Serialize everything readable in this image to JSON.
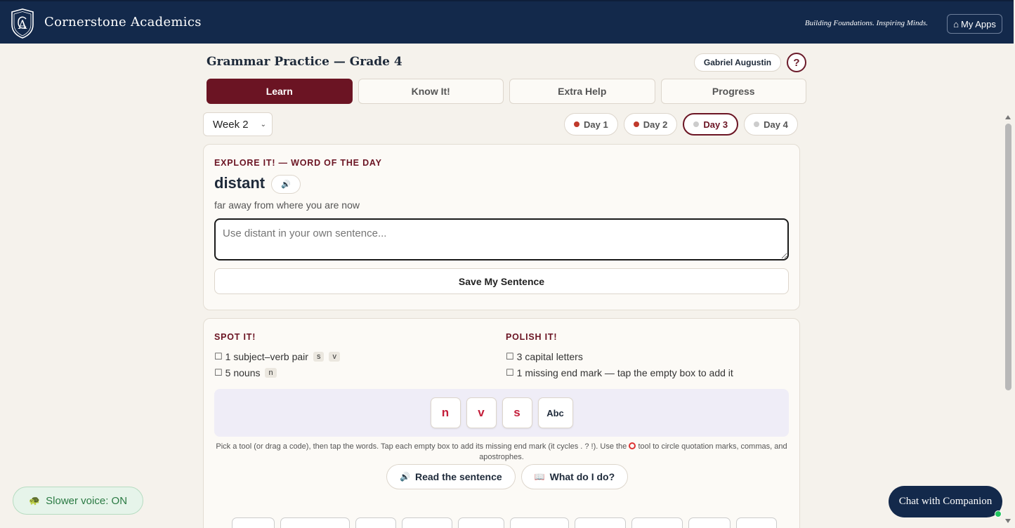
{
  "header": {
    "brand": "Cornerstone Academics",
    "tagline": "Building Foundations. Inspiring Minds.",
    "my_apps": "My Apps",
    "my_apps_icon": "home-icon"
  },
  "page": {
    "title": "Grammar Practice — Grade 4",
    "user_name": "Gabriel Augustin",
    "help_label": "?"
  },
  "tabs": [
    {
      "label": "Learn",
      "active": true
    },
    {
      "label": "Know It!",
      "active": false
    },
    {
      "label": "Extra Help",
      "active": false
    },
    {
      "label": "Progress",
      "active": false
    }
  ],
  "week": {
    "selected": "Week 2"
  },
  "days": [
    {
      "label": "Day 1",
      "status": "done"
    },
    {
      "label": "Day 2",
      "status": "done"
    },
    {
      "label": "Day 3",
      "status": "current"
    },
    {
      "label": "Day 4",
      "status": "pending"
    }
  ],
  "explore": {
    "heading": "EXPLORE IT! — WORD OF THE DAY",
    "word": "distant",
    "definition": "far away from where you are now",
    "input_placeholder": "Use distant in your own sentence...",
    "save_label": "Save My Sentence"
  },
  "spot": {
    "heading": "SPOT IT!",
    "items": [
      {
        "text": "1 subject–verb pair",
        "codes": [
          "s",
          "v"
        ]
      },
      {
        "text": "5 nouns",
        "codes": [
          "n"
        ]
      }
    ]
  },
  "polish": {
    "heading": "POLISH IT!",
    "items": [
      {
        "text": "3 capital letters"
      },
      {
        "text": "1 missing end mark — tap the empty box to add it"
      }
    ]
  },
  "tools": [
    {
      "label": "n"
    },
    {
      "label": "v"
    },
    {
      "label": "s"
    },
    {
      "label": "Abc"
    }
  ],
  "instructions": {
    "before_icon": "Pick a tool (or drag a code), then tap the words. Tap each empty box to add its missing end mark (it cycles . ? !). Use the",
    "after_icon": "tool to circle quotation marks, commas, and apostrophes."
  },
  "actions": {
    "read_label": "Read the sentence",
    "what_label": "What do I do?"
  },
  "floating": {
    "slower_voice": "Slower voice: ON",
    "chat": "Chat with Companion"
  },
  "colors": {
    "navy": "#13294b",
    "maroon": "#6b1423",
    "code_red": "#c41e3a"
  }
}
